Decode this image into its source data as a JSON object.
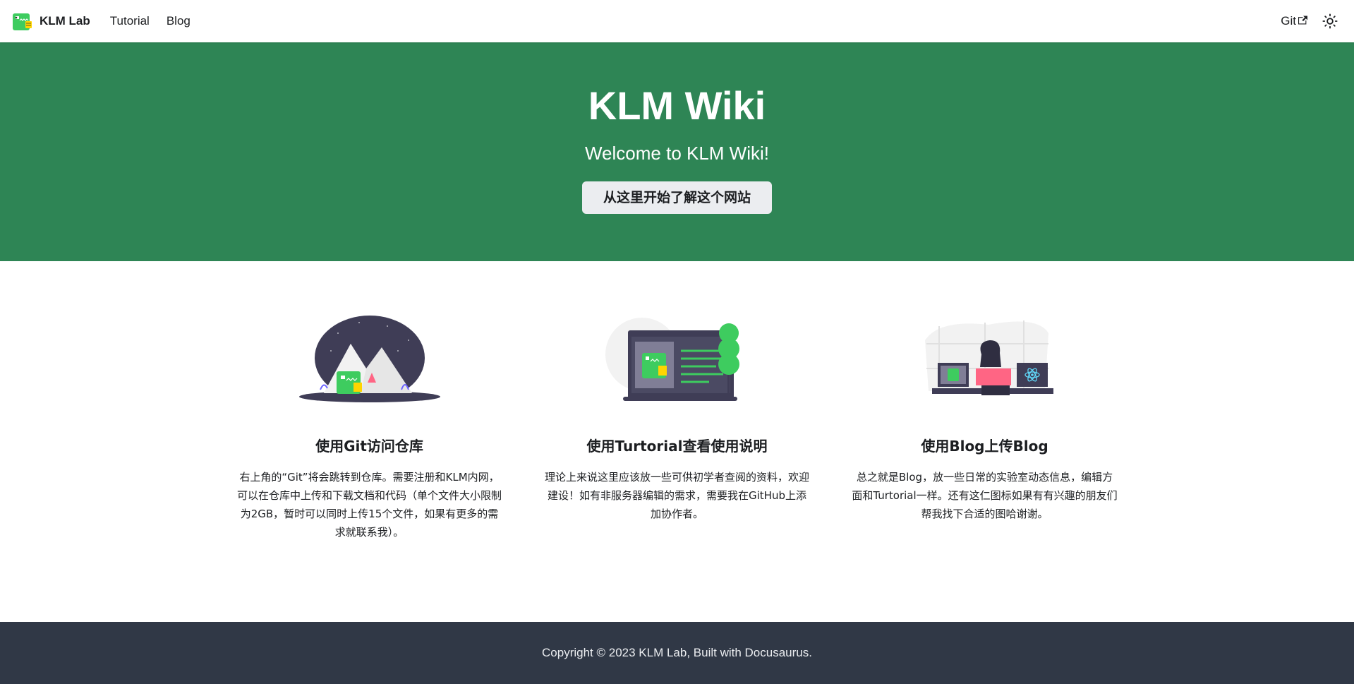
{
  "navbar": {
    "brand": "KLM Lab",
    "links": [
      "Tutorial",
      "Blog"
    ],
    "git_link": "Git",
    "logo_icon": "dinosaur-logo-icon",
    "theme_icon": "sun-icon"
  },
  "hero": {
    "title": "KLM Wiki",
    "subtitle": "Welcome to KLM Wiki!",
    "button": "从这里开始了解这个网站"
  },
  "features": [
    {
      "title": "使用Git访问仓库",
      "description": "右上角的“Git”将会跳转到仓库。需要注册和KLM内网，可以在仓库中上传和下载文档和代码（单个文件大小限制为2GB，暂时可以同时上传15个文件，如果有更多的需求就联系我）。",
      "illustration": "mountain-illustration"
    },
    {
      "title": "使用Turtorial查看使用说明",
      "description": "理论上来说这里应该放一些可供初学者查阅的资料，欢迎建设！如有非服务器编辑的需求，需要我在GitHub上添加协作者。",
      "illustration": "tree-illustration"
    },
    {
      "title": "使用Blog上传Blog",
      "description": "总之就是Blog，放一些日常的实验室动态信息，编辑方面和Turtorial一样。还有这仁图标如果有有兴趣的朋友们帮我找下合适的图哈谢谢。",
      "illustration": "react-illustration"
    }
  ],
  "footer": {
    "copyright": "Copyright © 2023 KLM Lab, Built with Docusaurus."
  },
  "colors": {
    "primary": "#2e8555",
    "footer_bg": "#303846",
    "button_bg": "#ebedf0"
  }
}
